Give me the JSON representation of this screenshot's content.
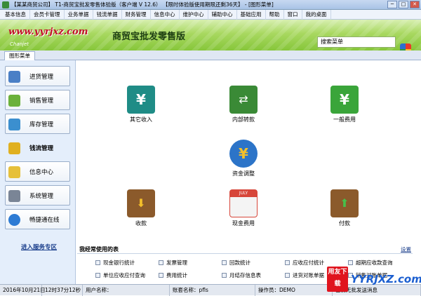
{
  "window": {
    "title": "【某某商贸公司】 T1-商贸宝批发零售体验版（客户端 V 12.6） 【限时体验版使用期限还剩36天】 - [图形菜单]",
    "minimize_glyph": "─",
    "maximize_glyph": "□",
    "close_glyph": "✕"
  },
  "menubar": [
    "基本信息",
    "会员卡管理",
    "业务单据",
    "钱流单据",
    "财务管理",
    "信息中心",
    "维护中心",
    "辅助中心",
    "基础应用",
    "帮助",
    "窗口",
    "我的桌面"
  ],
  "banner": {
    "logo_text": "www.yyrjxz.com",
    "product_title": "商贸宝批发零售版",
    "brand": "Chanjet",
    "search_placeholder": "搜索菜单"
  },
  "tab": {
    "label": "图形菜单"
  },
  "sidebar": {
    "items": [
      {
        "label": "进货管理",
        "icon": "purchase-icon",
        "color": "#4a7fc6"
      },
      {
        "label": "销售管理",
        "icon": "cart-icon",
        "color": "#6bb13a"
      },
      {
        "label": "库存管理",
        "icon": "inventory-icon",
        "color": "#3b8fcf"
      },
      {
        "label": "钱流管理",
        "icon": "money-flow-icon",
        "color": "#e0b020"
      },
      {
        "label": "信息中心",
        "icon": "mail-icon",
        "color": "#e6c03a"
      },
      {
        "label": "系统管理",
        "icon": "system-icon",
        "color": "#7a8596"
      },
      {
        "label": "畅捷通在线",
        "icon": "globe-icon",
        "color": "#2d7bd4"
      }
    ],
    "service_link": "进入服务专区"
  },
  "tiles": [
    {
      "label": "其它收入",
      "icon": "yen-card-icon",
      "color": "#1f8c86"
    },
    {
      "label": "内部转款",
      "icon": "transfer-icon",
      "color": "#3a8a36"
    },
    {
      "label": "一般费用",
      "icon": "yen-green-icon",
      "color": "#3aa53a"
    },
    {
      "label": "资金调整",
      "icon": "coin-adjust-icon",
      "color": "#2c74c8"
    },
    {
      "label": "收款",
      "icon": "chest-in-icon",
      "color": "#8b5a2b"
    },
    {
      "label": "现金费用",
      "icon": "calendar-coin-icon",
      "color": "#d7463a"
    },
    {
      "label": "付款",
      "icon": "chest-out-icon",
      "color": "#8b5a2b"
    }
  ],
  "calendar_label": "JULY",
  "favorites": {
    "header": "我经常使用的表",
    "settings": "设置",
    "items": [
      "现金银行统计",
      "发票管理",
      "回款统计",
      "应收应付统计",
      "超期应收款查询",
      "单位应收应付查询",
      "费用统计",
      "月结存信息表",
      "进货对账单据",
      "销售对账单据"
    ]
  },
  "status": {
    "date": "2016年10月21日",
    "time": "12时37分12秒",
    "user_label": "用户名称：",
    "account": "账套名称：pfls",
    "operator": "操作员：DEMO",
    "extra": "当前无批发送消息"
  },
  "watermark": {
    "logo": "用友下载",
    "text": "YYRJXZ.com"
  }
}
